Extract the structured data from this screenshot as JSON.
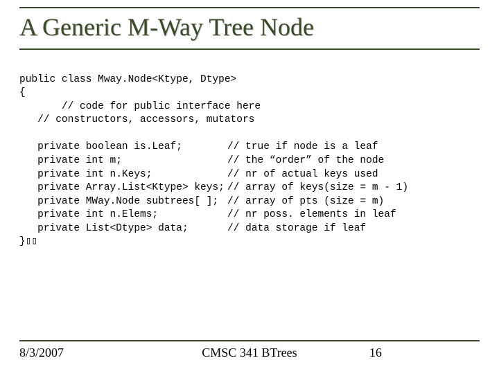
{
  "title": "A Generic M-Way Tree Node",
  "code": {
    "l1": "public class Mway.Node<Ktype, Dtype>",
    "l2": "{",
    "l3": "       // code for public interface here",
    "l4": "   // constructors, accessors, mutators",
    "blank1": "",
    "f1a": "   private boolean is.Leaf;",
    "f1b": "// true if node is a leaf",
    "f2a": "   private int m;",
    "f2b": "// the “order” of the node",
    "f3a": "   private int n.Keys;",
    "f3b": "// nr of actual keys used",
    "f4a": "   private Array.List<Ktype> keys;",
    "f4b": "// array of keys(size = m - 1)",
    "f5a": "   private MWay.Node subtrees[ ];",
    "f5b": "// array of pts (size = m)",
    "f6a": "   private int n.Elems;",
    "f6b": "// nr poss. elements in leaf",
    "f7a": "   private List<Dtype> data;",
    "f7b": "// data storage if leaf",
    "close": "}▯▯"
  },
  "footer": {
    "date": "8/3/2007",
    "center": "CMSC 341 BTrees",
    "page": "16"
  }
}
